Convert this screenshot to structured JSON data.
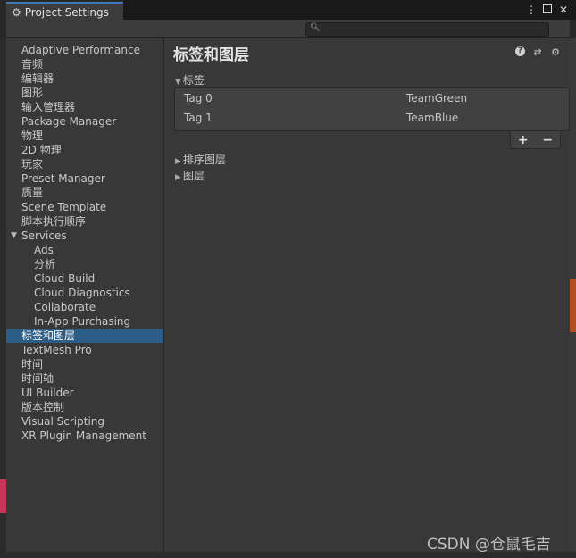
{
  "window": {
    "title": "Project Settings",
    "controls": {
      "menu": "⋮",
      "close": "✕"
    }
  },
  "search": {
    "placeholder": "",
    "value": ""
  },
  "sidebar": {
    "items": [
      {
        "label": "Adaptive Performance"
      },
      {
        "label": "音频"
      },
      {
        "label": "编辑器"
      },
      {
        "label": "图形"
      },
      {
        "label": "输入管理器"
      },
      {
        "label": "Package Manager"
      },
      {
        "label": "物理"
      },
      {
        "label": "2D 物理"
      },
      {
        "label": "玩家"
      },
      {
        "label": "Preset Manager"
      },
      {
        "label": "质量"
      },
      {
        "label": "Scene Template"
      },
      {
        "label": "脚本执行顺序"
      },
      {
        "label": "Services",
        "expanded": true
      },
      {
        "label": "Ads",
        "child": true
      },
      {
        "label": "分析",
        "child": true
      },
      {
        "label": "Cloud Build",
        "child": true
      },
      {
        "label": "Cloud Diagnostics",
        "child": true
      },
      {
        "label": "Collaborate",
        "child": true
      },
      {
        "label": "In-App Purchasing",
        "child": true
      },
      {
        "label": "标签和图层",
        "selected": true
      },
      {
        "label": "TextMesh Pro"
      },
      {
        "label": "时间"
      },
      {
        "label": "时间轴"
      },
      {
        "label": "UI Builder"
      },
      {
        "label": "版本控制"
      },
      {
        "label": "Visual Scripting"
      },
      {
        "label": "XR Plugin Management"
      }
    ]
  },
  "main": {
    "title": "标签和图层",
    "tags_section": "标签",
    "tags": [
      {
        "name": "Tag 0",
        "value": "TeamGreen"
      },
      {
        "name": "Tag 1",
        "value": "TeamBlue"
      }
    ],
    "add_label": "+",
    "remove_label": "−",
    "sorting_layers_section": "排序图层",
    "layers_section": "图层"
  },
  "watermark": "CSDN @仓鼠毛吉",
  "colors": {
    "selected_bg": "#2c5d87",
    "tab_accent": "#3a79bb",
    "panel_bg": "#383838"
  },
  "icons": [
    "gear-icon",
    "menu-icon",
    "maximize-icon",
    "close-icon",
    "search-icon",
    "help-icon",
    "preset-icon",
    "settings-icon",
    "foldout-arrow-icon"
  ]
}
